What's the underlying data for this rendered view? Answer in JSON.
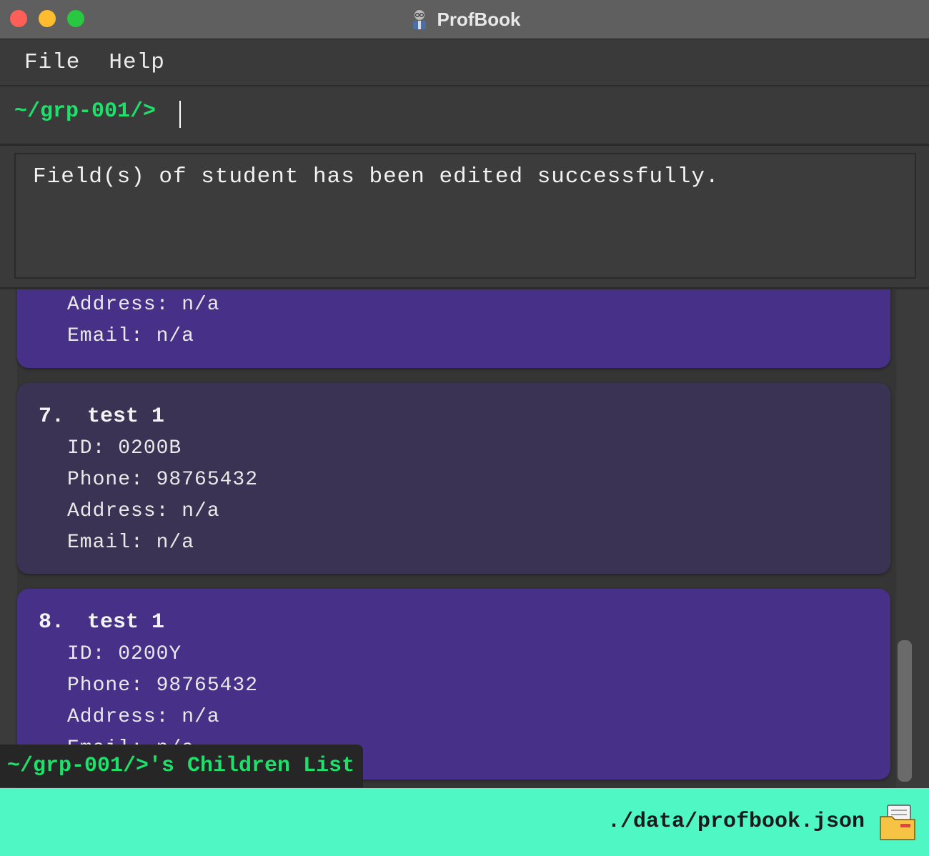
{
  "window": {
    "title": "ProfBook",
    "app_icon": "professor-avatar-icon"
  },
  "menu": {
    "items": [
      {
        "label": "File"
      },
      {
        "label": "Help"
      }
    ]
  },
  "command": {
    "prompt": "~/grp-001/>",
    "value": ""
  },
  "result": {
    "message": "Field(s) of student has been edited successfully."
  },
  "list": {
    "label": "~/grp-001/>'s Children List",
    "partial_card": {
      "address": "Address: n/a",
      "email": "Email: n/a"
    },
    "cards": [
      {
        "index": "7.",
        "name": "test 1",
        "id": "ID: 0200B",
        "phone": "Phone: 98765432",
        "address": "Address: n/a",
        "email": "Email: n/a"
      },
      {
        "index": "8.",
        "name": "test 1",
        "id": "ID: 0200Y",
        "phone": "Phone: 98765432",
        "address": "Address: n/a",
        "email": "Email: n/a"
      }
    ]
  },
  "status": {
    "path": "./data/profbook.json",
    "icon": "folder-icon"
  },
  "colors": {
    "accent_green": "#1ee06a",
    "card_purple": "#473087",
    "card_dark": "#3b3354",
    "status_bar": "#4ff7c5"
  }
}
